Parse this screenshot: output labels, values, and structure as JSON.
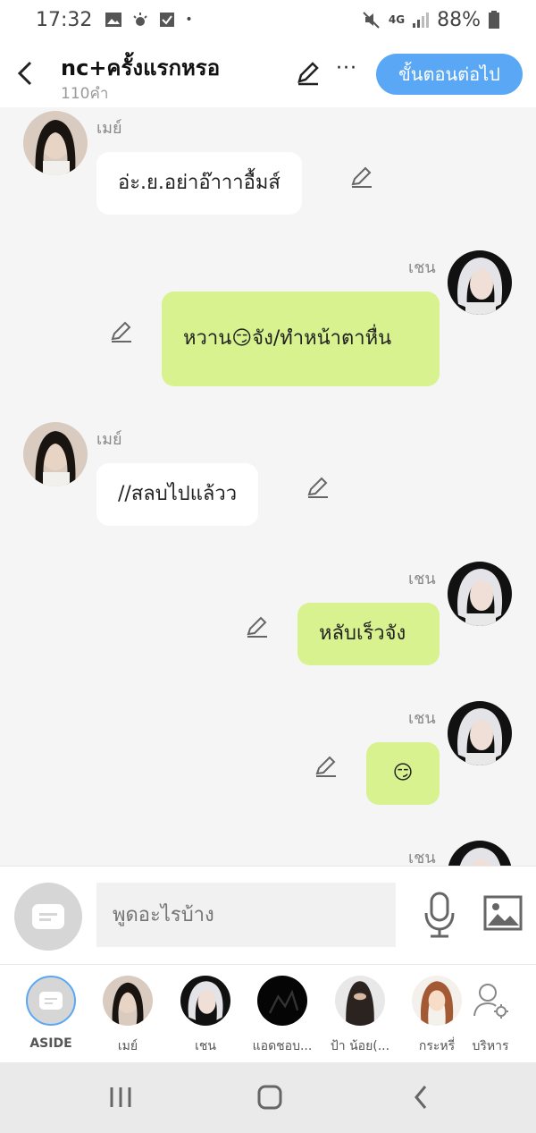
{
  "status": {
    "time": "17:32",
    "network": "4G",
    "battery": "88%"
  },
  "header": {
    "title": "nc+ครั้งแรกหรอ",
    "subtitle": "110คำ",
    "next_label": "ขั้นตอนต่อไป"
  },
  "messages": [
    {
      "sender": "เมย์",
      "side": "left",
      "text": "อ่ะ.ย.อย่าอ๊าาาอื้มส์"
    },
    {
      "sender": "เชน",
      "side": "right",
      "text": "หวาน😏จัง/ทำหน้าตาหื่น"
    },
    {
      "sender": "เมย์",
      "side": "left",
      "text": "//สลบไปแล้วว"
    },
    {
      "sender": "เชน",
      "side": "right",
      "text": "หลับเร็วจัง"
    },
    {
      "sender": "เชน",
      "side": "right",
      "text": "😏"
    },
    {
      "sender": "เชน",
      "side": "right",
      "text": ""
    }
  ],
  "composer": {
    "placeholder": "พูดอะไรบ้าง"
  },
  "characters": [
    {
      "label": "ASIDE"
    },
    {
      "label": "เมย์"
    },
    {
      "label": "เชน"
    },
    {
      "label": "แอดชอบ..."
    },
    {
      "label": "ป้า น้อย(..."
    },
    {
      "label": "กระหรี่"
    },
    {
      "label": "บริหาร"
    }
  ],
  "colors": {
    "accent": "#5aa8f5",
    "bubble_right": "#d7f28e",
    "bubble_left": "#ffffff"
  }
}
